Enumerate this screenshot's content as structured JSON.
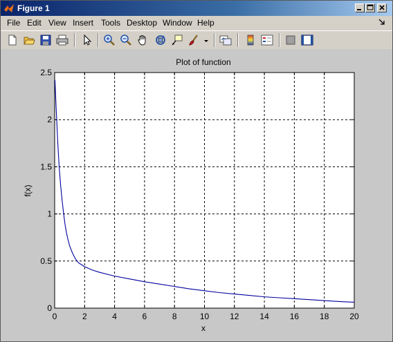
{
  "window": {
    "title": "Figure 1"
  },
  "menu": {
    "items": [
      "File",
      "Edit",
      "View",
      "Insert",
      "Tools",
      "Desktop",
      "Window",
      "Help"
    ]
  },
  "toolbar": {
    "buttons": [
      {
        "name": "new-figure-icon"
      },
      {
        "name": "open-file-icon"
      },
      {
        "name": "save-icon"
      },
      {
        "name": "print-icon"
      },
      {
        "name": "edit-plot-arrow-icon"
      },
      {
        "name": "zoom-in-icon"
      },
      {
        "name": "zoom-out-icon"
      },
      {
        "name": "pan-hand-icon"
      },
      {
        "name": "rotate-3d-icon"
      },
      {
        "name": "data-cursor-icon"
      },
      {
        "name": "brush-icon"
      },
      {
        "name": "link-plot-icon"
      },
      {
        "name": "insert-colorbar-icon"
      },
      {
        "name": "insert-legend-icon"
      },
      {
        "name": "hide-plot-tools-icon"
      },
      {
        "name": "show-plot-tools-icon"
      }
    ]
  },
  "chart_data": {
    "type": "line",
    "title": "Plot of function",
    "xlabel": "x",
    "ylabel": "f(x)",
    "xlim": [
      0,
      20
    ],
    "ylim": [
      0,
      2.5
    ],
    "xticks": [
      "0",
      "2",
      "4",
      "6",
      "8",
      "10",
      "12",
      "14",
      "16",
      "18",
      "20"
    ],
    "yticks": [
      "0",
      "0.5",
      "1",
      "1.5",
      "2",
      "2.5"
    ],
    "grid": true,
    "series": [
      {
        "color": "#0000a0",
        "x": [
          0.02,
          0.1,
          0.2,
          0.3,
          0.4,
          0.5,
          0.6,
          0.7,
          0.8,
          0.9,
          1.0,
          1.2,
          1.4,
          1.6,
          1.8,
          2.0,
          2.5,
          3,
          4,
          5,
          6,
          7,
          8,
          9,
          10,
          11,
          12,
          13,
          14,
          15,
          16,
          17,
          18,
          19,
          20
        ],
        "y": [
          2.42,
          2.12,
          1.78,
          1.5,
          1.3,
          1.14,
          1.0,
          0.88,
          0.79,
          0.72,
          0.66,
          0.58,
          0.52,
          0.48,
          0.46,
          0.44,
          0.405,
          0.38,
          0.34,
          0.31,
          0.28,
          0.255,
          0.23,
          0.205,
          0.185,
          0.165,
          0.15,
          0.135,
          0.12,
          0.11,
          0.1,
          0.09,
          0.08,
          0.07,
          0.063
        ]
      }
    ]
  }
}
